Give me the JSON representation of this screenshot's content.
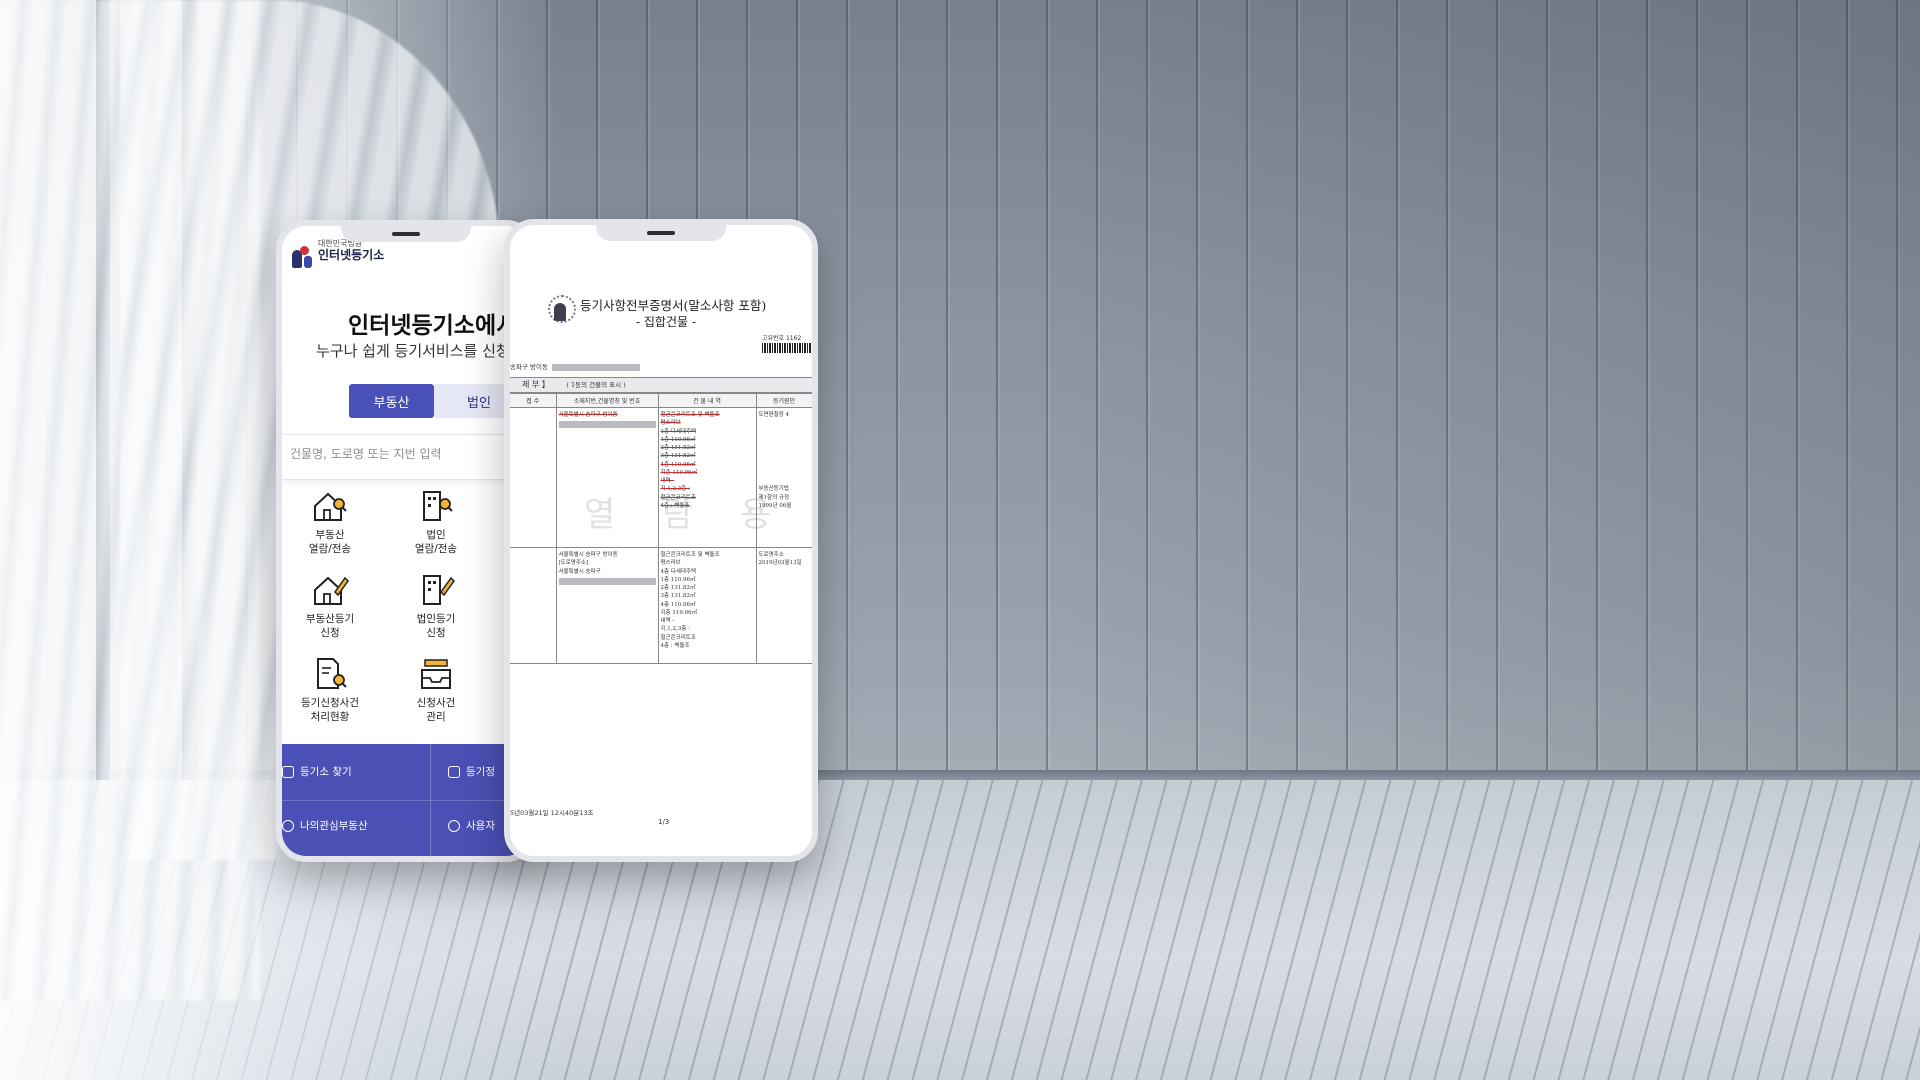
{
  "app": {
    "logo_sub": "대한민국법원",
    "logo_main": "인터넷등기소",
    "hero_title": "인터넷등기소에서",
    "hero_subtitle": "누구나 쉽게 등기서비스를 신청",
    "tabs": [
      {
        "label": "부동산",
        "active": true
      },
      {
        "label": "법인",
        "active": false
      }
    ],
    "search": {
      "placeholder": "건물명, 도로명 또는 지번 입력"
    },
    "menu": [
      {
        "label": "부동산\n열람/전송",
        "icon": "house-search-icon"
      },
      {
        "label": "법인\n열람/전송",
        "icon": "building-search-icon"
      },
      {
        "label": "부동산등기\n신청",
        "icon": "house-pencil-icon"
      },
      {
        "label": "법인등기\n신청",
        "icon": "building-pencil-icon"
      },
      {
        "label": "등기신청사건\n처리현황",
        "icon": "document-search-icon"
      },
      {
        "label": "신청사건\n관리",
        "icon": "inbox-tray-icon"
      }
    ],
    "bottom_links": [
      {
        "label": "등기소 찾기",
        "icon": "location-icon"
      },
      {
        "label": "등기정",
        "icon": "clipboard-icon"
      },
      {
        "label": "나의관심부동산",
        "icon": "check-circle-icon"
      },
      {
        "label": "사용자",
        "icon": "phone-icon"
      }
    ],
    "colors": {
      "primary": "#4a50b4",
      "tab_inactive_bg": "#e6e7f4"
    }
  },
  "document": {
    "title": "등기사항전부증명서(말소사항 포함)",
    "subtitle": "- 집합건물 -",
    "serial_label": "고유번호 1162",
    "address": "송파구 방이동",
    "section_title": "제 부 】",
    "section_note": "( 1동의 건물의 표시 )",
    "columns": [
      "접 수",
      "소재지번,건물명칭 및 번호",
      "건 물 내 역",
      "등기원인"
    ],
    "rows": [
      {
        "received": "",
        "location": "서울특별시 송파구 방이동",
        "building": "철근콘크리트조 및 벽돌조\n평스라브\n1층 다세대주택\n1층 110.96㎡\n2층 131.82㎡\n3층 131.82㎡\n4층 110.06㎡\n지층 119.96㎡\n내역 -\n지 1,2,3층 :\n철근콘크리트조\n4층 : 벽돌조",
        "cause": "도면편철장 4\n\n\n\n\n\n\n\n\n부동산등기법\n제1항의 규정\n1999년 06월"
      },
      {
        "received": "",
        "location": "서울특별시 송파구 방이동\n[도로명주소]\n서울특별시 송파구",
        "building": "철근콘크리트조 및 벽돌조\n평스라브\n4층 다세대주택\n1층 110.96㎡\n2층 131.82㎡\n3층 131.82㎡\n4층 110.06㎡\n지층 119.06㎡\n내역 -\n지,1,2,3층 :\n철근콘크리트조\n4층 : 벽돌조",
        "cause": "도로명주소\n2019년03월13일"
      }
    ],
    "watermark": "열 람 용",
    "footer_time": "5년03월21일 12시40분13초",
    "page": "1/3"
  }
}
